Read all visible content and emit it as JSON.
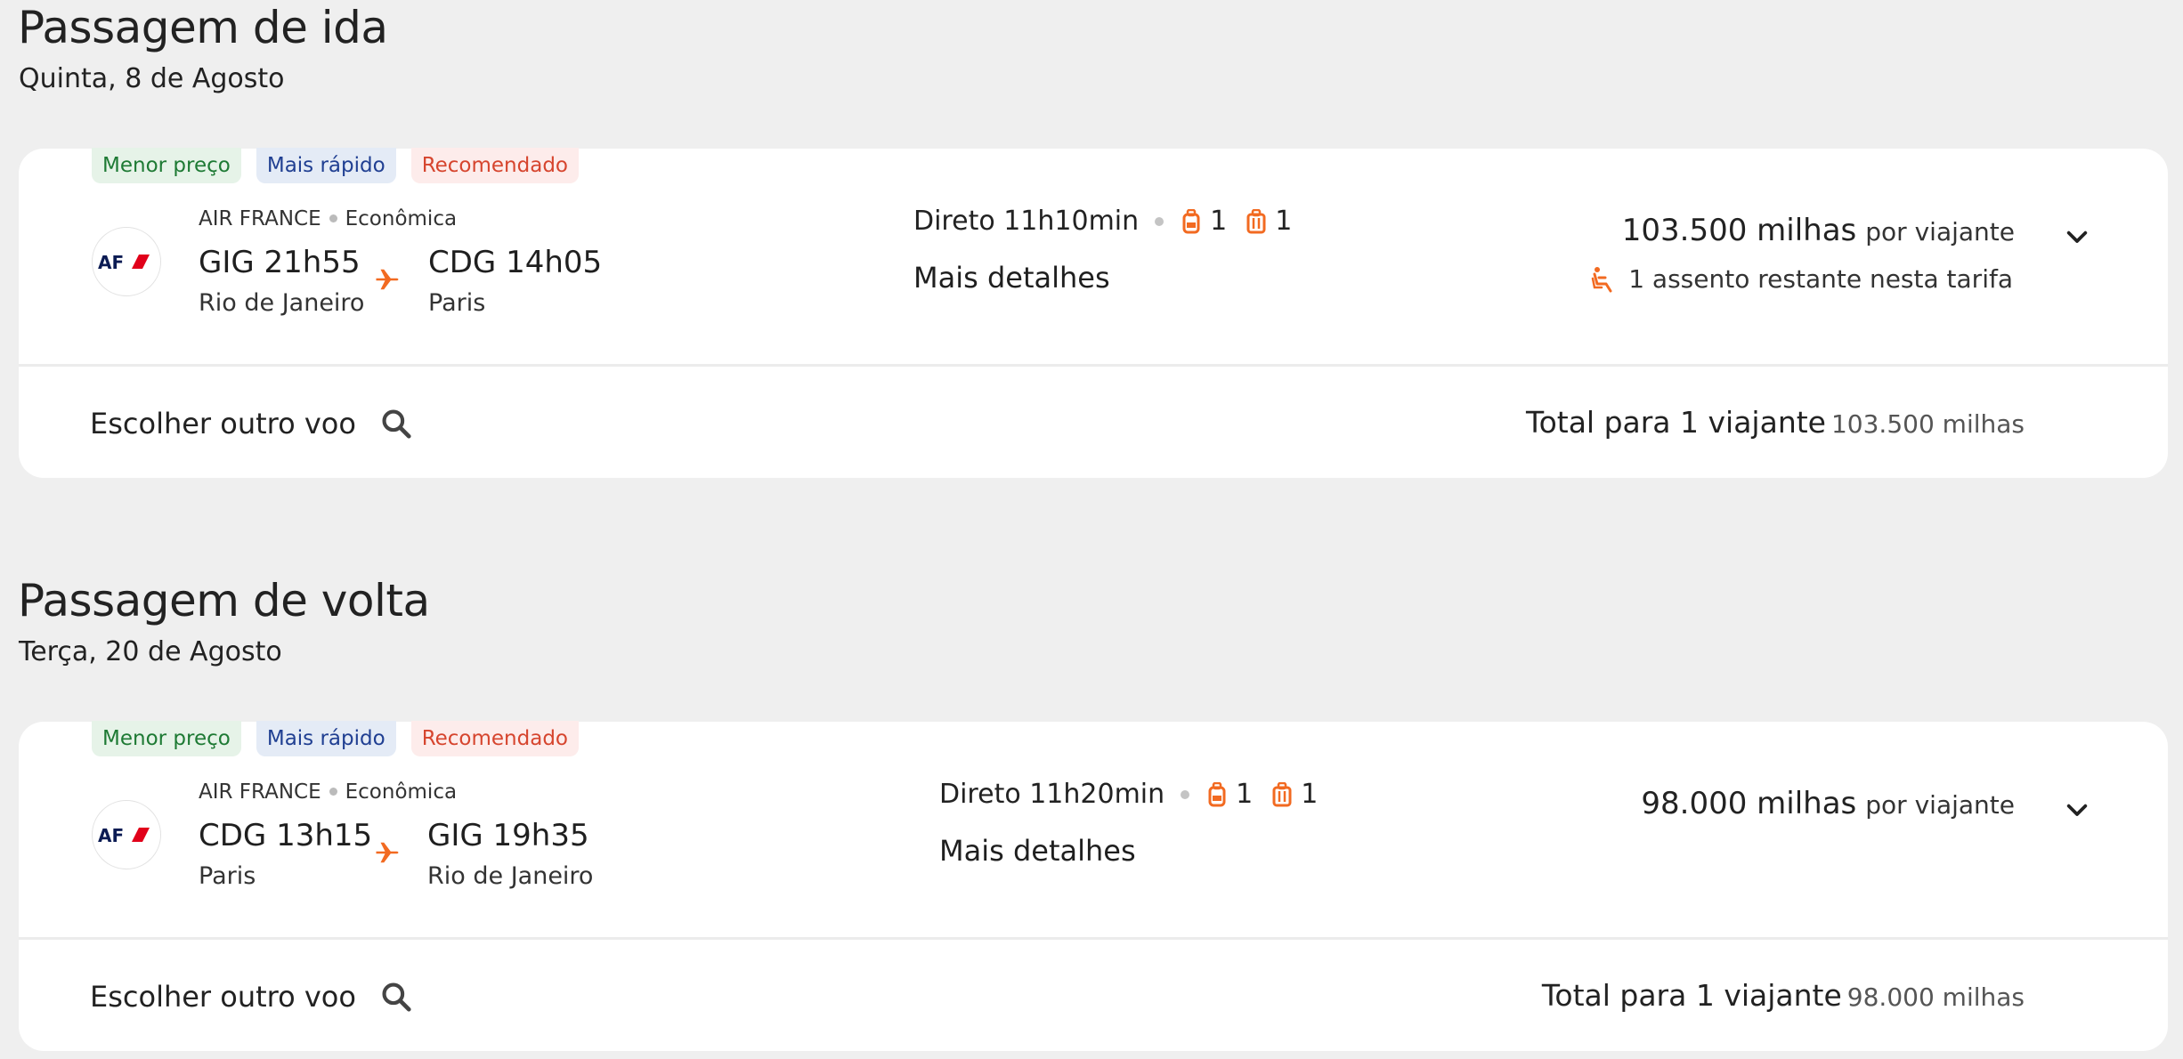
{
  "outbound": {
    "title": "Passagem de ida",
    "date": "Quinta, 8 de Agosto",
    "badges": [
      "Menor preço",
      "Mais rápido",
      "Recomendado"
    ],
    "airline": "AIR FRANCE",
    "cabin": "Econômica",
    "origin_code_time": "GIG 21h55",
    "origin_city": "Rio de Janeiro",
    "dest_code_time": "CDG 14h05",
    "dest_city": "Paris",
    "duration": "Direto 11h10min",
    "carry_on_count": "1",
    "checked_count": "1",
    "details_link": "Mais detalhes",
    "price": "103.500 milhas",
    "price_unit": "por viajante",
    "seats_left": "1 assento restante nesta tarifa",
    "choose_other": "Escolher outro voo",
    "total_label": "Total para 1 viajante",
    "total_value": "103.500 milhas"
  },
  "return": {
    "title": "Passagem de volta",
    "date": "Terça, 20 de Agosto",
    "badges": [
      "Menor preço",
      "Mais rápido",
      "Recomendado"
    ],
    "airline": "AIR FRANCE",
    "cabin": "Econômica",
    "origin_code_time": "CDG 13h15",
    "origin_city": "Paris",
    "dest_code_time": "GIG 19h35",
    "dest_city": "Rio de Janeiro",
    "duration": "Direto 11h20min",
    "carry_on_count": "1",
    "checked_count": "1",
    "details_link": "Mais detalhes",
    "price": "98.000 milhas",
    "price_unit": "por viajante",
    "choose_other": "Escolher outro voo",
    "total_label": "Total para 1 viajante",
    "total_value": "98.000 milhas"
  },
  "logo_text": "AF",
  "icons": {
    "plane": "plane-icon",
    "carry_on": "backpack-icon",
    "checked": "suitcase-icon",
    "seat": "seat-icon",
    "search": "search-icon",
    "expand": "chevron-down-icon"
  },
  "colors": {
    "accent": "#f26a21",
    "background": "#efefef",
    "card": "#ffffff",
    "badge_green_text": "#1e7a34",
    "badge_blue_text": "#203f92",
    "badge_red_text": "#d6452e",
    "af_navy": "#0b1b53",
    "af_red": "#e1001a"
  }
}
